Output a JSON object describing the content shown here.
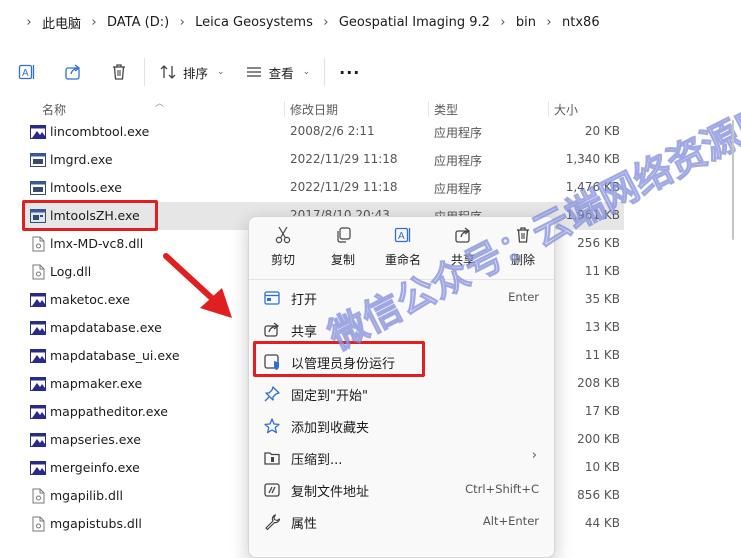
{
  "breadcrumb": [
    "此电脑",
    "DATA (D:)",
    "Leica Geosystems",
    "Geospatial Imaging 9.2",
    "bin",
    "ntx86"
  ],
  "toolbar": {
    "sort_label": "排序",
    "view_label": "查看",
    "more_label": "···"
  },
  "columns": {
    "name": "名称",
    "date": "修改日期",
    "type": "类型",
    "size": "大小"
  },
  "files": [
    {
      "name": "lincombtool.exe",
      "date": "2008/2/6 2:11",
      "type": "应用程序",
      "size": "20 KB",
      "icon": "app-icon"
    },
    {
      "name": "lmgrd.exe",
      "date": "2022/11/29 11:18",
      "type": "应用程序",
      "size": "1,340 KB",
      "icon": "window-icon"
    },
    {
      "name": "lmtools.exe",
      "date": "2022/11/29 11:18",
      "type": "应用程序",
      "size": "1,476 KB",
      "icon": "window-icon"
    },
    {
      "name": "lmtoolsZH.exe",
      "date": "2017/8/10 20:43",
      "type": "应用程序",
      "size": "1,961 KB",
      "icon": "tools-icon"
    },
    {
      "name": "lmx-MD-vc8.dll",
      "date": "",
      "type": "",
      "size": "256 KB",
      "icon": "dll-icon"
    },
    {
      "name": "Log.dll",
      "date": "",
      "type": "",
      "size": "11 KB",
      "icon": "dll-icon"
    },
    {
      "name": "maketoc.exe",
      "date": "",
      "type": "",
      "size": "35 KB",
      "icon": "app-icon"
    },
    {
      "name": "mapdatabase.exe",
      "date": "",
      "type": "",
      "size": "13 KB",
      "icon": "app-icon"
    },
    {
      "name": "mapdatabase_ui.exe",
      "date": "",
      "type": "",
      "size": "11 KB",
      "icon": "app-icon"
    },
    {
      "name": "mapmaker.exe",
      "date": "",
      "type": "",
      "size": "208 KB",
      "icon": "app-icon"
    },
    {
      "name": "mappatheditor.exe",
      "date": "",
      "type": "",
      "size": "17 KB",
      "icon": "app-icon"
    },
    {
      "name": "mapseries.exe",
      "date": "",
      "type": "",
      "size": "200 KB",
      "icon": "app-icon"
    },
    {
      "name": "mergeinfo.exe",
      "date": "",
      "type": "",
      "size": "10 KB",
      "icon": "app-icon"
    },
    {
      "name": "mgapilib.dll",
      "date": "",
      "type": "",
      "size": "856 KB",
      "icon": "dll-icon"
    },
    {
      "name": "mgapistubs.dll",
      "date": "",
      "type": "",
      "size": "44 KB",
      "icon": "dll-icon"
    }
  ],
  "context_menu": {
    "quick_actions": [
      {
        "label": "剪切",
        "icon": "cut-icon"
      },
      {
        "label": "复制",
        "icon": "copy-icon"
      },
      {
        "label": "重命名",
        "icon": "rename-icon"
      },
      {
        "label": "共享",
        "icon": "share-icon"
      },
      {
        "label": "删除",
        "icon": "delete-icon"
      }
    ],
    "items": [
      {
        "label": "打开",
        "shortcut": "Enter",
        "icon": "open-icon"
      },
      {
        "label": "共享",
        "shortcut": "",
        "icon": "share-icon"
      },
      {
        "label": "以管理员身份运行",
        "shortcut": "",
        "icon": "shield-icon"
      },
      {
        "label": "固定到\"开始\"",
        "shortcut": "",
        "icon": "pin-icon"
      },
      {
        "label": "添加到收藏夹",
        "shortcut": "",
        "icon": "star-icon"
      },
      {
        "label": "压缩到...",
        "shortcut": "",
        "icon": "archive-icon"
      },
      {
        "label": "复制文件地址",
        "shortcut": "Ctrl+Shift+C",
        "icon": "path-icon"
      },
      {
        "label": "属性",
        "shortcut": "Alt+Enter",
        "icon": "wrench-icon"
      }
    ]
  },
  "watermark_text": "微信公众号：云端网络资源库",
  "colors": {
    "highlight": "#e02020",
    "accent": "#2f6fd3",
    "selected_row": "#e6e6e6"
  }
}
